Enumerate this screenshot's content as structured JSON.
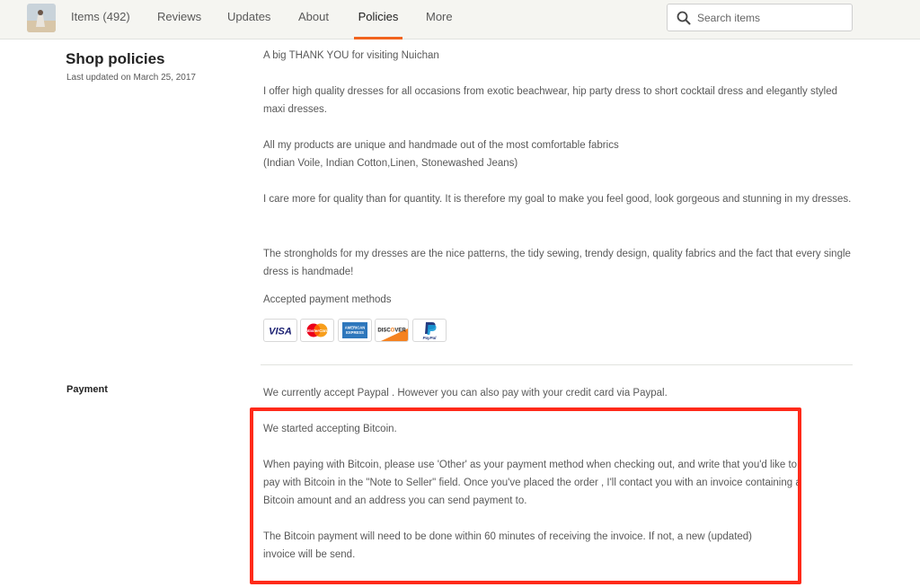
{
  "nav": {
    "tabs": [
      {
        "label": "Items (492)"
      },
      {
        "label": "Reviews"
      },
      {
        "label": "Updates"
      },
      {
        "label": "About"
      },
      {
        "label": "Policies"
      },
      {
        "label": "More"
      }
    ],
    "active_tab": "Policies",
    "search": {
      "placeholder": "Search items",
      "value": ""
    }
  },
  "shop_policies": {
    "title": "Shop policies",
    "last_updated": "Last updated on March 25, 2017",
    "paragraphs": [
      "A big THANK YOU for visiting Nuichan",
      "I offer high quality dresses for all occasions from exotic beachwear, hip party dress to short cocktail dress and elegantly styled maxi dresses.",
      "All my products are unique and handmade out of the most comfortable fabrics",
      "(Indian Voile, Indian Cotton,Linen, Stonewashed Jeans)",
      "I care more for quality than for quantity. It is therefore my goal to make you feel good, look gorgeous and stunning in my dresses.",
      "The strongholds for my dresses are the nice patterns, the tidy sewing, trendy design, quality fabrics and the fact that every single dress is handmade!"
    ],
    "payment_methods_heading": "Accepted payment methods",
    "payment_methods": [
      {
        "name": "visa-card-icon",
        "label": "VISA"
      },
      {
        "name": "mastercard-icon",
        "label": "MasterCard"
      },
      {
        "name": "amex-card-icon",
        "label": "AMERICAN EXPRESS"
      },
      {
        "name": "discover-card-icon",
        "label": "DISCOVER"
      },
      {
        "name": "paypal-icon",
        "label": "PayPal"
      }
    ]
  },
  "payment": {
    "label": "Payment",
    "paragraphs": [
      "We currently accept Paypal . However you can also pay with your credit card via Paypal.",
      "We started accepting Bitcoin.",
      "When paying with Bitcoin, please use 'Other' as your payment method when checking out, and write that you'd like to pay with Bitcoin in the \"Note to Seller\" field. Once you've placed the order , I'll contact you with an invoice containing a Bitcoin amount and an address you can send payment to.",
      "The Bitcoin payment will need to be done within 60 minutes of receiving the invoice. If not, a new (updated) invoice will be send."
    ]
  },
  "colors": {
    "accent": "#f1641e",
    "highlight_border": "#ff2a1a",
    "nav_bg": "#f5f5f1"
  }
}
